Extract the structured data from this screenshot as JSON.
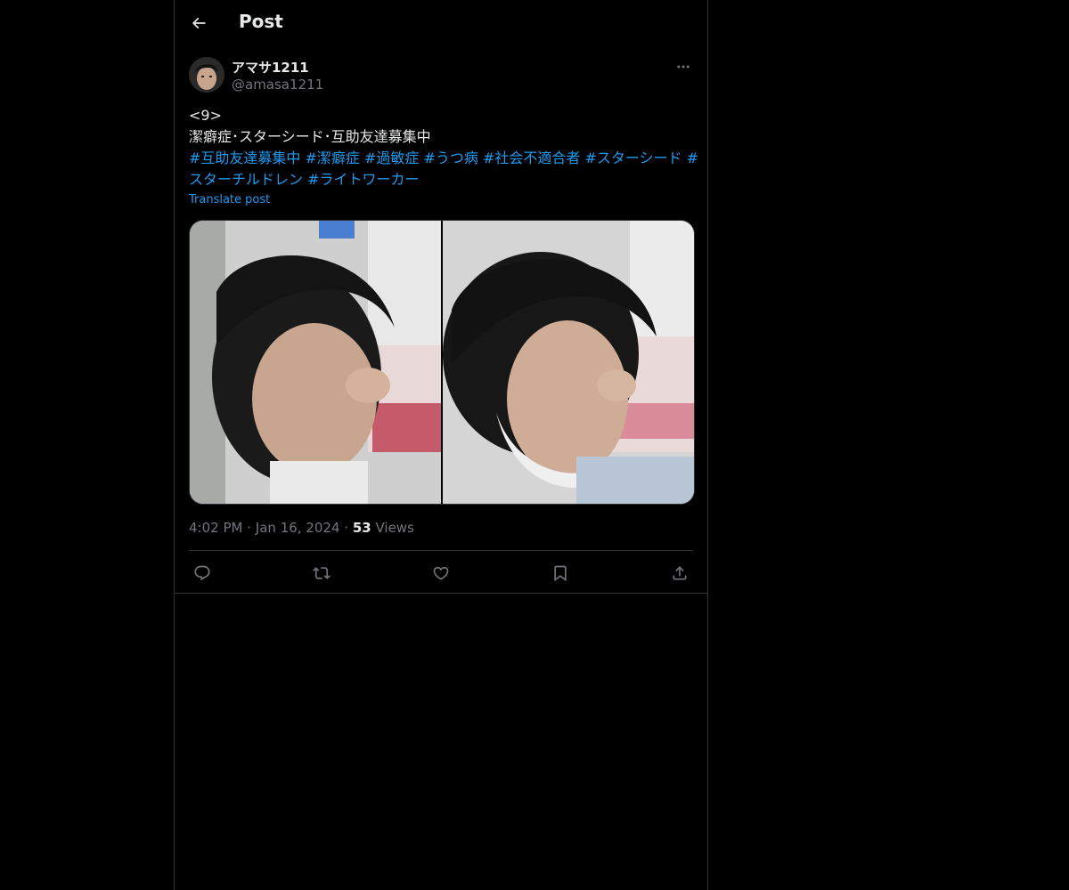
{
  "header": {
    "title": "Post"
  },
  "author": {
    "name": "アマサ1211",
    "handle": "@amasa1211"
  },
  "post": {
    "line1": "<9>",
    "line2": "潔癖症･スターシード･互助友達募集中",
    "hashtags_line1": "#互助友達募集中 #潔癖症 #過敏症 #うつ病 #社会不適合者 #スターシード #",
    "hashtags_line2": "スターチルドレン #ライトワーカー",
    "translate_label": "Translate post",
    "time": "4:02 PM",
    "date": "Jan 16, 2024",
    "views_count": "53",
    "views_label": "Views",
    "separator": "·"
  },
  "icons": {
    "back": "arrow-left-icon",
    "more": "more-horizontal-icon",
    "reply": "reply-icon",
    "repost": "repost-icon",
    "like": "heart-icon",
    "bookmark": "bookmark-icon",
    "share": "share-icon"
  },
  "colors": {
    "accent": "#1d9bf0",
    "background": "#000000",
    "text": "#e7e9ea",
    "secondary": "#71767b",
    "border": "#2f3336"
  }
}
